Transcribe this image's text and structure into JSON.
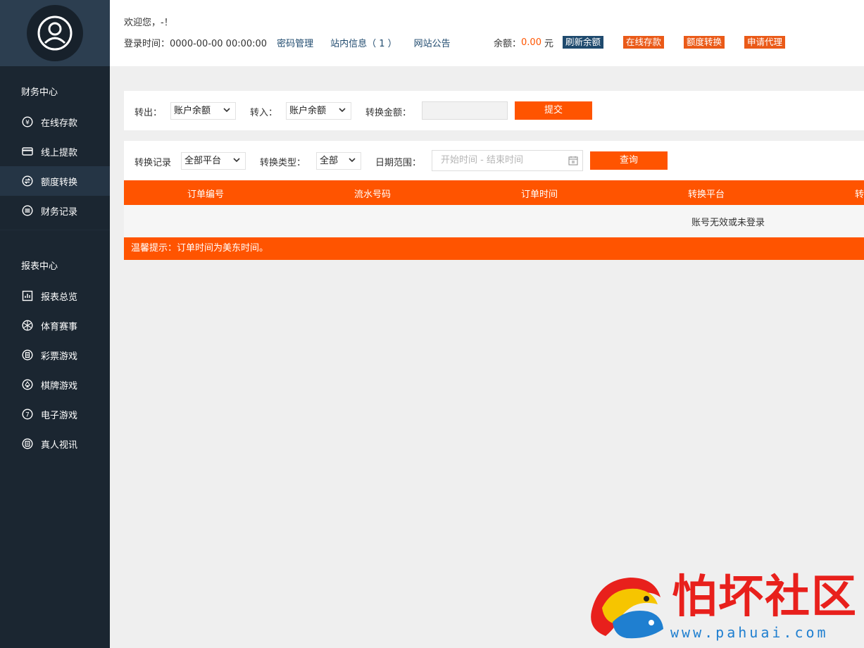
{
  "colors": {
    "sidebar_bg": "#1b2631",
    "accent_orange": "#ff5400",
    "link_blue": "#1f4a6e",
    "amount_orange": "#ff5500"
  },
  "sidebar": {
    "avatar_icon": "user-avatar-icon",
    "finance_title": "财务中心",
    "finance_items": [
      {
        "label": "在线存款",
        "icon": "yen-circle-icon"
      },
      {
        "label": "线上提款",
        "icon": "card-icon"
      },
      {
        "label": "额度转换",
        "icon": "transfer-icon",
        "active": true
      },
      {
        "label": "财务记录",
        "icon": "list-icon"
      }
    ],
    "report_title": "报表中心",
    "report_items": [
      {
        "label": "报表总览",
        "icon": "chart-icon"
      },
      {
        "label": "体育赛事",
        "icon": "ball-icon"
      },
      {
        "label": "彩票游戏",
        "icon": "lottery-icon"
      },
      {
        "label": "棋牌游戏",
        "icon": "spade-icon"
      },
      {
        "label": "电子游戏",
        "icon": "slot-icon"
      },
      {
        "label": "真人视讯",
        "icon": "video-icon"
      }
    ]
  },
  "header": {
    "welcome": "欢迎您，-！",
    "login_time": "登录时间：0000-00-00 00:00:00",
    "password_link": "密码管理",
    "messages_link": "站内信息（ 1 ）",
    "notice_link": "网站公告",
    "balance_label": "余额：",
    "balance_amount": "0.00",
    "balance_unit": "元",
    "refresh_btn": "刷新余额",
    "deposit_btn": "在线存款",
    "transfer_btn": "额度转换",
    "agent_btn": "申请代理"
  },
  "transfer_form": {
    "out_label": "转出：",
    "out_value": "账户余额",
    "in_label": "转入：",
    "in_value": "账户余额",
    "amount_label": "转换金额：",
    "amount_value": "",
    "submit_label": "提交"
  },
  "filter": {
    "record_label": "转换记录",
    "platform_value": "全部平台",
    "type_label": "转换类型：",
    "type_value": "全部",
    "date_label": "日期范围：",
    "date_placeholder": "开始时间 - 结束时间",
    "query_label": "查询"
  },
  "table": {
    "headers": [
      "订单编号",
      "流水号码",
      "订单时间",
      "转换平台",
      "转"
    ],
    "empty_text": "账号无效或未登录"
  },
  "tip": "温馨提示：订单时间为美东时间。",
  "watermark": {
    "title": "怕坏社区",
    "url": "www.pahuai.com"
  }
}
